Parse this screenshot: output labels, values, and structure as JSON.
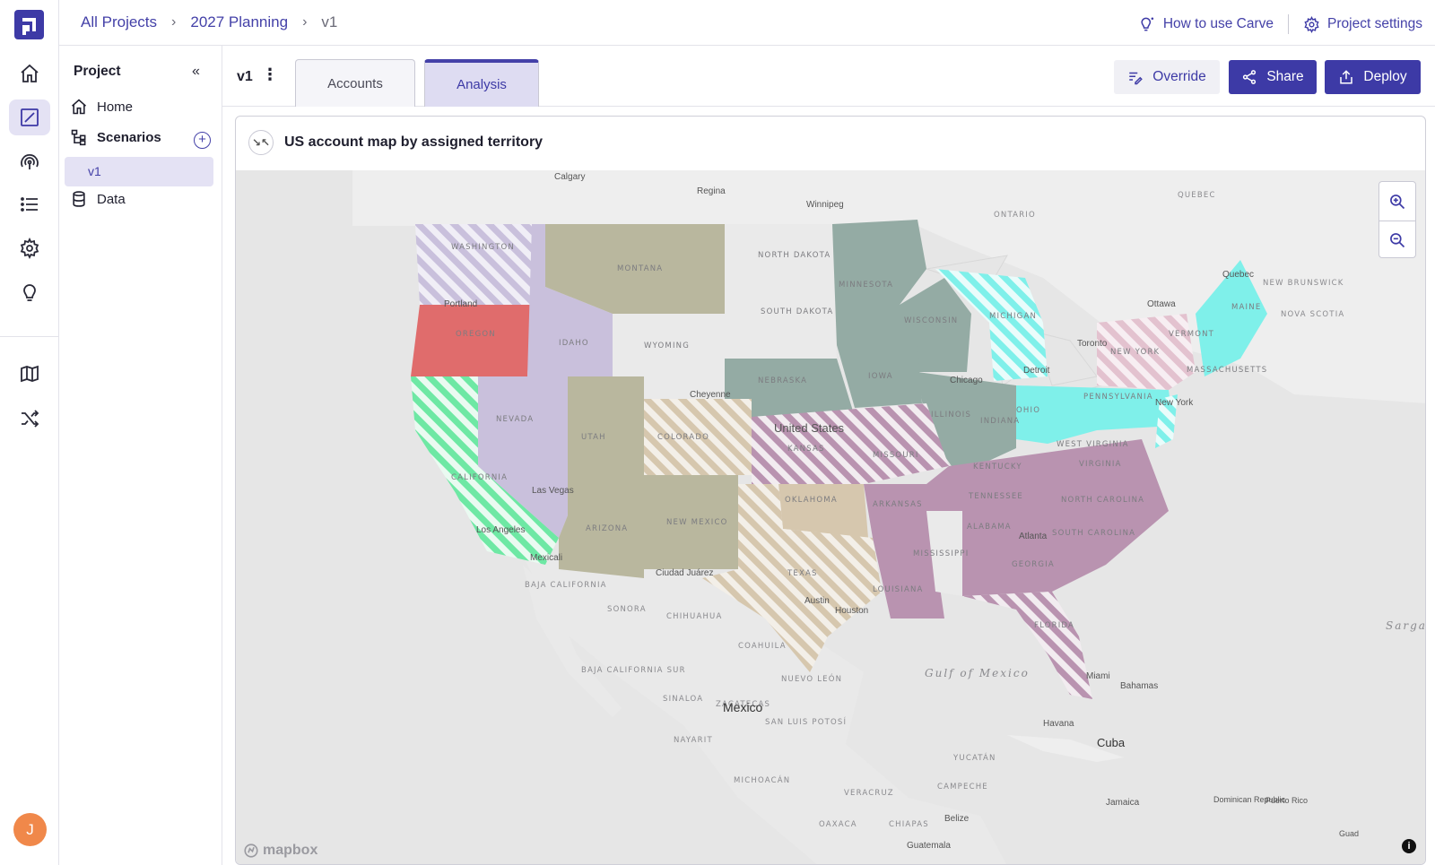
{
  "breadcrumb": [
    "All Projects",
    "2027 Planning",
    "v1"
  ],
  "top_links": {
    "help": "How to use Carve",
    "settings": "Project settings"
  },
  "sidebar": {
    "title": "Project",
    "items": [
      "Home",
      "Scenarios",
      "v1",
      "Data"
    ]
  },
  "scenario": {
    "name": "v1"
  },
  "tabs": [
    {
      "label": "Accounts",
      "active": false
    },
    {
      "label": "Analysis",
      "active": true
    }
  ],
  "actions": {
    "override": "Override",
    "share": "Share",
    "deploy": "Deploy"
  },
  "user": {
    "initial": "J"
  },
  "map": {
    "title": "US account map by assigned territory",
    "attribution": "mapbox",
    "cities": [
      "Calgary",
      "Regina",
      "Winnipeg",
      "Quebec",
      "Ottawa",
      "Toronto",
      "Detroit",
      "Chicago",
      "New York",
      "Cheyenne",
      "Las Vegas",
      "Los Angeles",
      "Mexicali",
      "Ciudad Juárez",
      "Austin",
      "Houston",
      "Atlanta",
      "Miami",
      "Portland",
      "Mexico",
      "Havana",
      "Cuba",
      "Bahamas",
      "Jamaica",
      "Belize",
      "Guatemala",
      "Dominican Republic",
      "Puerto Rico",
      "Guad"
    ],
    "regions": [
      "ONTARIO",
      "QUEBEC",
      "NEW BRUNSWICK",
      "NOVA SCOTIA",
      "SONORA",
      "CHIHUAHUA",
      "COAHUILA",
      "NUEVO LEÓN",
      "SINALOA",
      "BAJA CALIFORNIA",
      "BAJA CALIFORNIA SUR",
      "SAN LUIS POTOSÍ",
      "ZACATECAS",
      "NAYARIT",
      "MICHOACÁN",
      "OAXACA",
      "CHIAPAS",
      "VERACRUZ",
      "CAMPECHE",
      "YUCATÁN"
    ],
    "water": [
      "Gulf of Mexico",
      "Sargasso Sea"
    ],
    "country": "United States",
    "states": [
      "WASHINGTON",
      "OREGON",
      "IDAHO",
      "MONTANA",
      "WYOMING",
      "NORTH DAKOTA",
      "SOUTH DAKOTA",
      "NEBRASKA",
      "MINNESOTA",
      "WISCONSIN",
      "MICHIGAN",
      "IOWA",
      "ILLINOIS",
      "INDIANA",
      "OHIO",
      "PENNSYLVANIA",
      "NEW YORK",
      "VERMONT",
      "MAINE",
      "MASSACHUSETTS",
      "NEVADA",
      "UTAH",
      "COLORADO",
      "KANSAS",
      "MISSOURI",
      "KENTUCKY",
      "WEST VIRGINIA",
      "VIRGINIA",
      "TENNESSEE",
      "NORTH CAROLINA",
      "SOUTH CAROLINA",
      "GEORGIA",
      "ALABAMA",
      "MISSISSIPPI",
      "ARKANSAS",
      "LOUISIANA",
      "OKLAHOMA",
      "TEXAS",
      "NEW MEXICO",
      "ARIZONA",
      "CALIFORNIA",
      "FLORIDA"
    ],
    "territory_colors": {
      "red": "#e06c6c",
      "lavender": "#c9c0dc",
      "olive": "#b9b79e",
      "teal": "#94aba4",
      "cyan": "#7ff0ea",
      "green": "#6ee8a4",
      "mauve": "#b993b0",
      "pink": "#e3c2cf",
      "sand": "#d6c7ae",
      "neutral": "#eaeaea"
    }
  },
  "colors": {
    "accent": "#3d3aa6",
    "accent_light": "#e4e2f4",
    "avatar": "#f0884a"
  }
}
